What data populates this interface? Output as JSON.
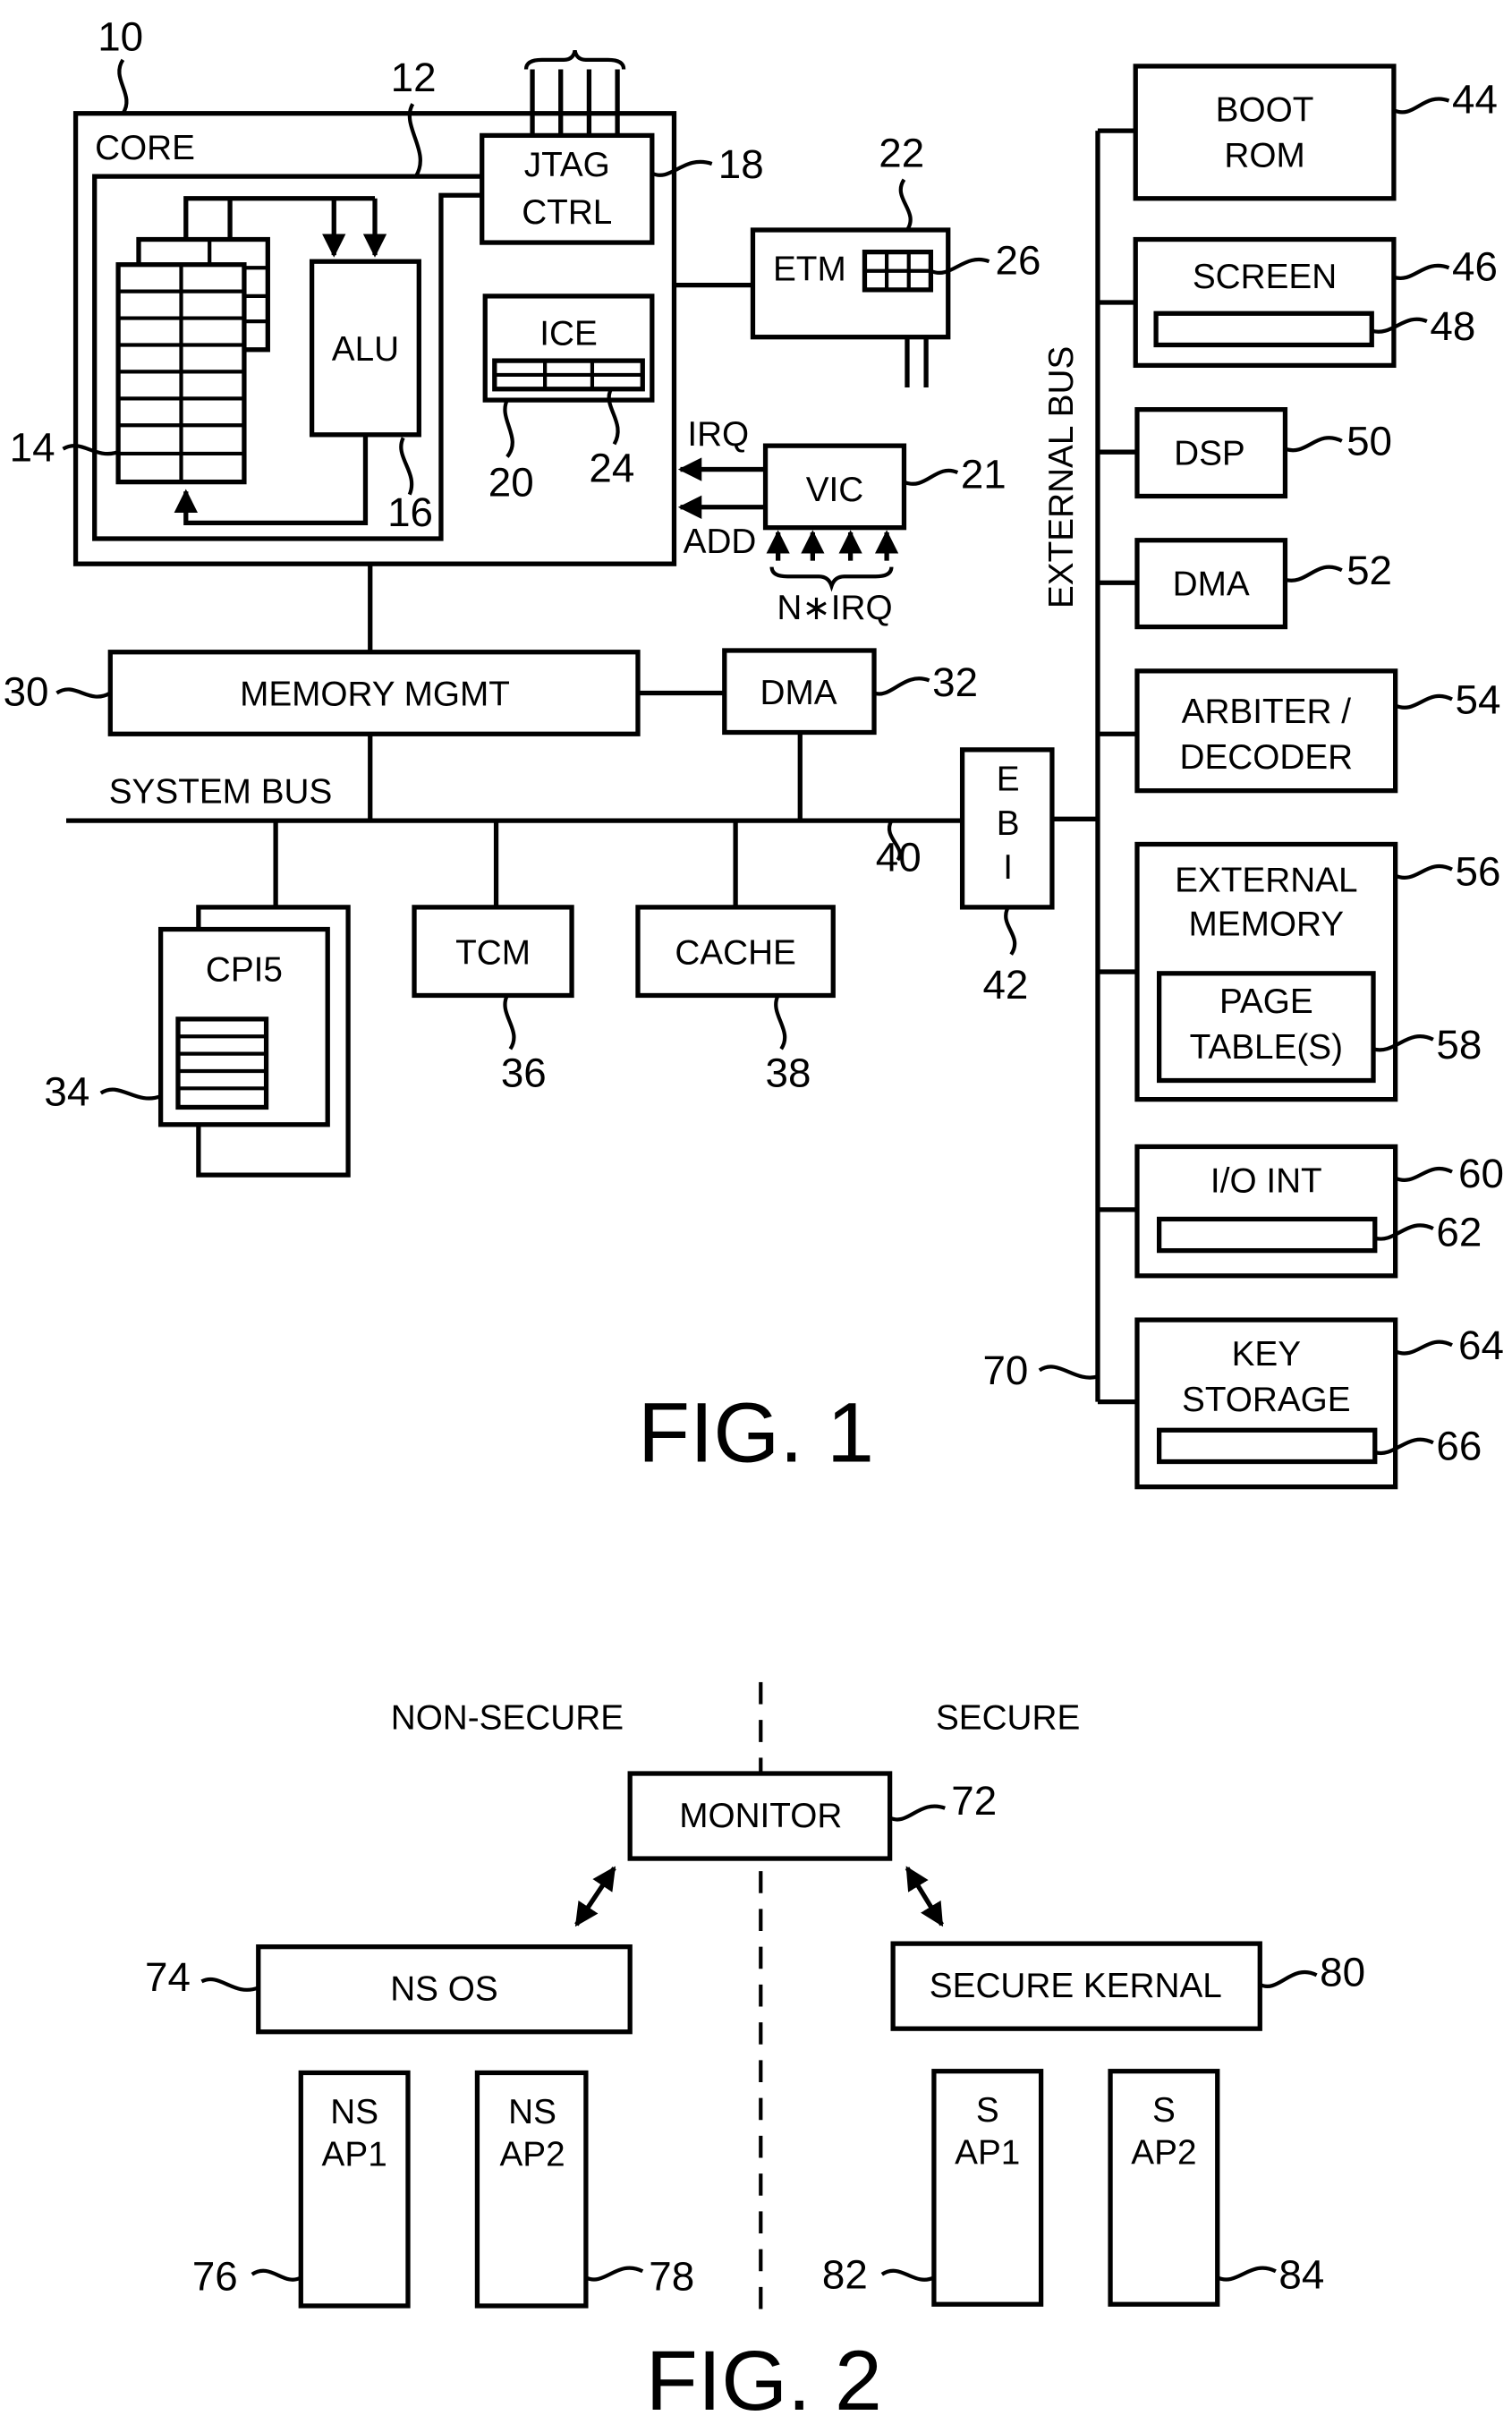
{
  "fig1": {
    "caption": "FIG. 1",
    "core": {
      "label": "CORE",
      "ref": "10",
      "bus_ref": "12"
    },
    "register_bank": {
      "ref": "14"
    },
    "alu": {
      "label": "ALU",
      "ref": "16"
    },
    "jtag": {
      "line1": "JTAG",
      "line2": "CTRL",
      "ref": "18"
    },
    "ice": {
      "label": "ICE",
      "ref": "20",
      "register_ref": "24"
    },
    "vic": {
      "label": "VIC",
      "ref": "21",
      "irq_label": "IRQ",
      "add_label": "ADD",
      "nirq_label": "N∗IRQ"
    },
    "etm": {
      "label": "ETM",
      "ref": "22",
      "buffer_ref": "26"
    },
    "memory_mgmt": {
      "label": "MEMORY MGMT",
      "ref": "30"
    },
    "dma_sys": {
      "label": "DMA",
      "ref": "32"
    },
    "system_bus": {
      "label": "SYSTEM BUS",
      "ref": "40"
    },
    "cp15": {
      "label": "CPI5",
      "ref": "34"
    },
    "tcm": {
      "label": "TCM",
      "ref": "36"
    },
    "cache": {
      "label": "CACHE",
      "ref": "38"
    },
    "ebi": {
      "letters": [
        "E",
        "B",
        "I"
      ],
      "ref": "42"
    },
    "external_bus": {
      "label": "EXTERNAL BUS",
      "ref": "70"
    },
    "boot_rom": {
      "line1": "BOOT",
      "line2": "ROM",
      "ref": "44"
    },
    "screen": {
      "label": "SCREEN",
      "ref": "46",
      "inner_ref": "48"
    },
    "dsp": {
      "label": "DSP",
      "ref": "50"
    },
    "dma_ext": {
      "label": "DMA",
      "ref": "52"
    },
    "arbiter": {
      "line1": "ARBITER /",
      "line2": "DECODER",
      "ref": "54"
    },
    "ext_memory": {
      "line1": "EXTERNAL",
      "line2": "MEMORY",
      "ref": "56"
    },
    "page_tables": {
      "line1": "PAGE",
      "line2": "TABLE(S)",
      "ref": "58"
    },
    "io_int": {
      "label": "I/O INT",
      "ref": "60",
      "inner_ref": "62"
    },
    "key_storage": {
      "line1": "KEY",
      "line2": "STORAGE",
      "ref": "64",
      "inner_ref": "66"
    }
  },
  "fig2": {
    "caption": "FIG. 2",
    "non_secure_label": "NON-SECURE",
    "secure_label": "SECURE",
    "monitor": {
      "label": "MONITOR",
      "ref": "72"
    },
    "ns_os": {
      "label": "NS OS",
      "ref": "74"
    },
    "secure_kernel": {
      "label": "SECURE KERNAL",
      "ref": "80"
    },
    "ns_ap1": {
      "line1": "NS",
      "line2": "AP1",
      "ref": "76"
    },
    "ns_ap2": {
      "line1": "NS",
      "line2": "AP2",
      "ref": "78"
    },
    "s_ap1": {
      "line1": "S",
      "line2": "AP1",
      "ref": "82"
    },
    "s_ap2": {
      "line1": "S",
      "line2": "AP2",
      "ref": "84"
    }
  }
}
